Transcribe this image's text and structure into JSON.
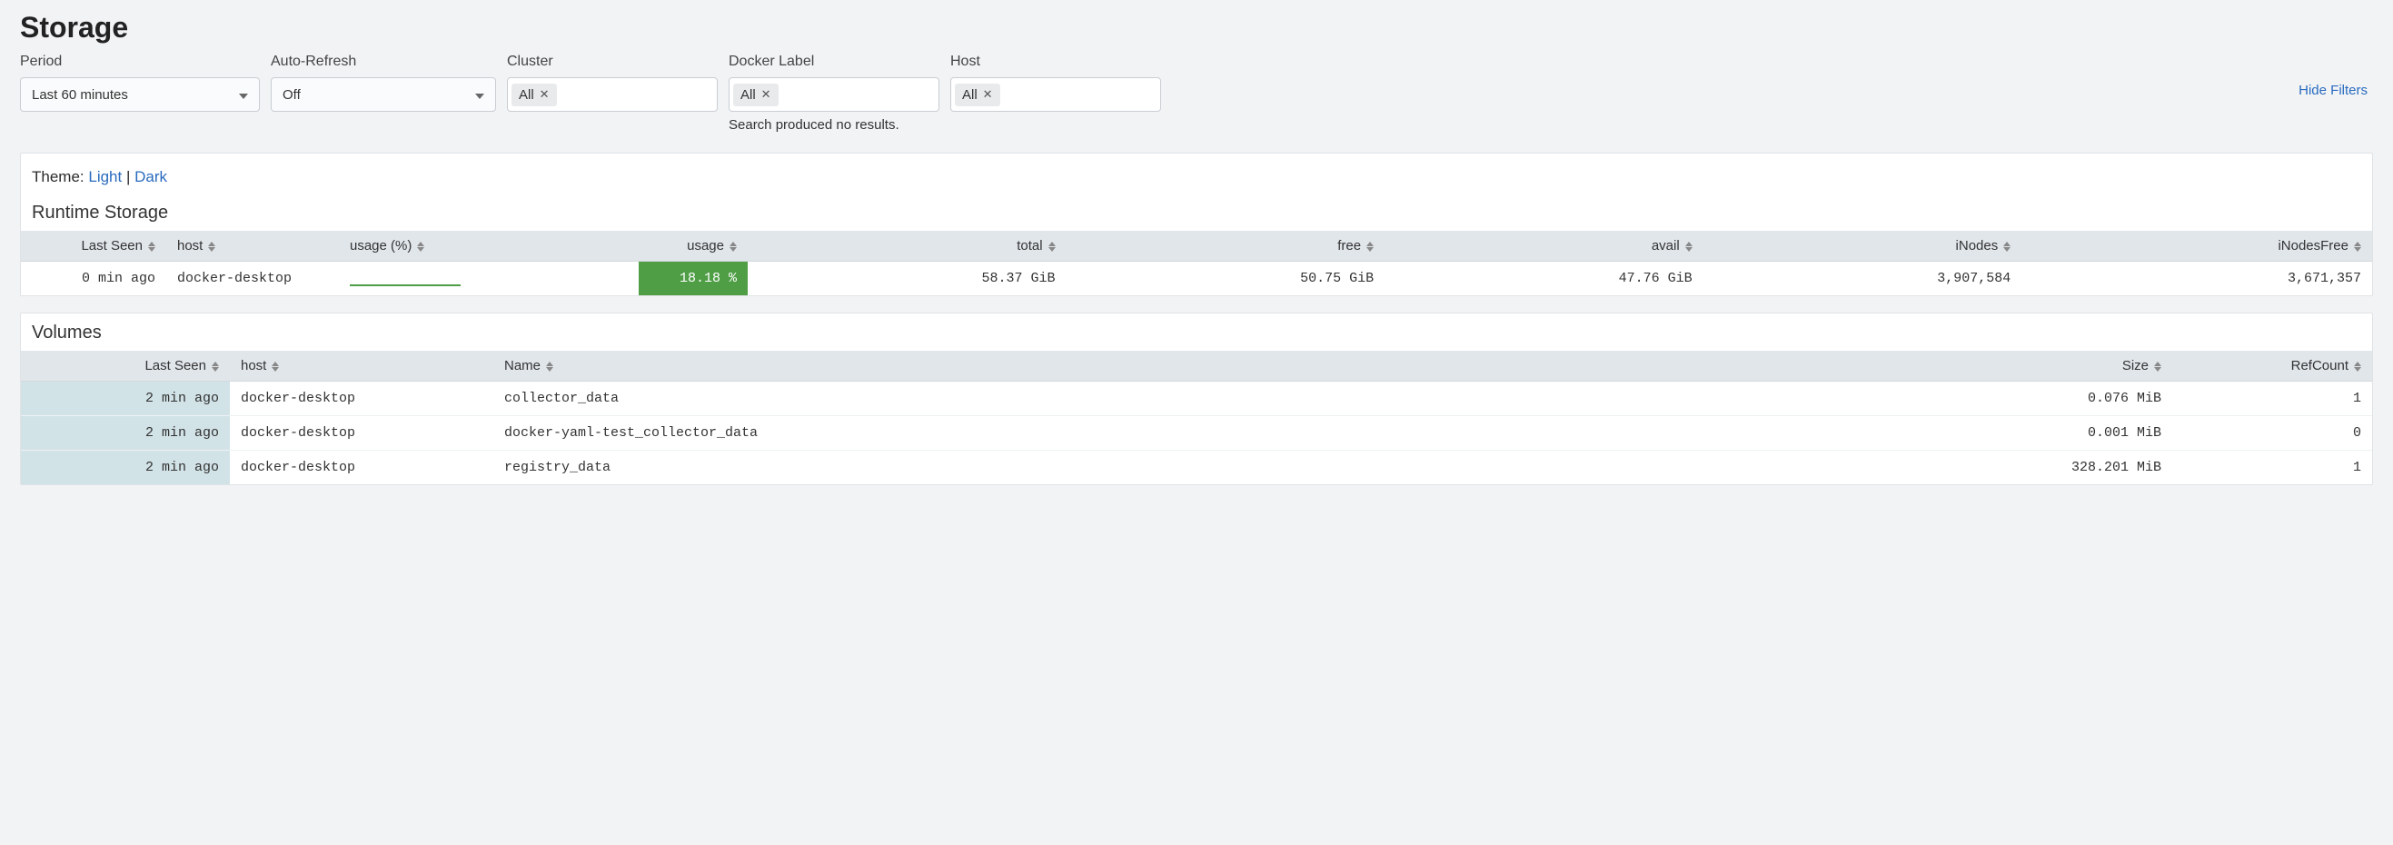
{
  "page": {
    "title": "Storage"
  },
  "filters": {
    "period": {
      "label": "Period",
      "value": "Last 60 minutes"
    },
    "auto_refresh": {
      "label": "Auto-Refresh",
      "value": "Off"
    },
    "cluster": {
      "label": "Cluster",
      "chip": "All"
    },
    "docker_label": {
      "label": "Docker Label",
      "chip": "All",
      "no_results": "Search produced no results."
    },
    "host": {
      "label": "Host",
      "chip": "All"
    },
    "hide_filters": "Hide Filters"
  },
  "theme": {
    "prefix": "Theme: ",
    "light": "Light",
    "sep": " | ",
    "dark": "Dark"
  },
  "runtime": {
    "title": "Runtime Storage",
    "headers": {
      "last_seen": "Last Seen",
      "host": "host",
      "usage_pct_hdr": "usage (%)",
      "usage": "usage",
      "total": "total",
      "free": "free",
      "avail": "avail",
      "inodes": "iNodes",
      "inodes_free": "iNodesFree"
    },
    "rows": [
      {
        "last_seen": "0 min ago",
        "host": "docker-desktop",
        "usage_pct": "18.18 %",
        "total": "58.37 GiB",
        "free": "50.75 GiB",
        "avail": "47.76 GiB",
        "inodes": "3,907,584",
        "inodes_free": "3,671,357"
      }
    ]
  },
  "volumes": {
    "title": "Volumes",
    "headers": {
      "last_seen": "Last Seen",
      "host": "host",
      "name": "Name",
      "size": "Size",
      "refcount": "RefCount"
    },
    "rows": [
      {
        "last_seen": "2 min ago",
        "host": "docker-desktop",
        "name": "collector_data",
        "size": "0.076 MiB",
        "refcount": "1"
      },
      {
        "last_seen": "2 min ago",
        "host": "docker-desktop",
        "name": "docker-yaml-test_collector_data",
        "size": "0.001 MiB",
        "refcount": "0"
      },
      {
        "last_seen": "2 min ago",
        "host": "docker-desktop",
        "name": "registry_data",
        "size": "328.201 MiB",
        "refcount": "1"
      }
    ]
  }
}
